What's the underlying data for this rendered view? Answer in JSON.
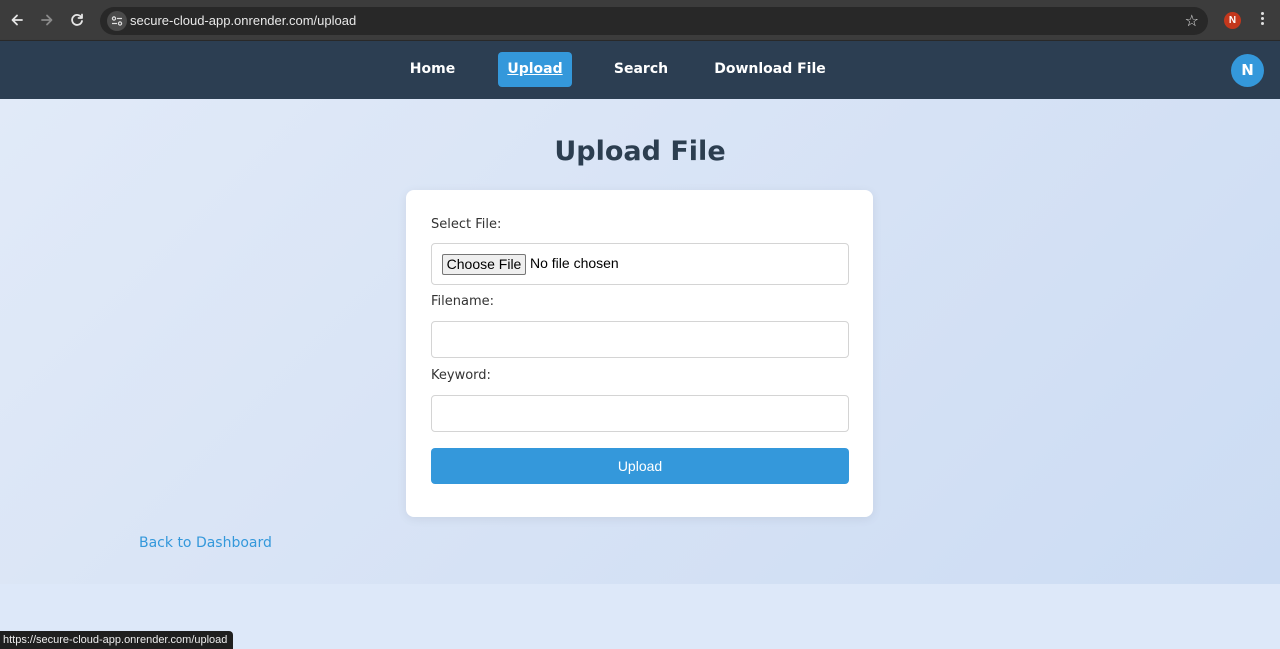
{
  "browser": {
    "url": "secure-cloud-app.onrender.com/upload",
    "profile_initial": "N",
    "status_url": "https://secure-cloud-app.onrender.com/upload",
    "icons": {
      "back": "arrow-left-icon",
      "forward": "arrow-right-icon",
      "reload": "reload-icon",
      "site_info": "tune-icon",
      "bookmark": "star-icon",
      "menu": "kebab-menu-icon"
    }
  },
  "nav": {
    "items": [
      {
        "label": "Home",
        "active": false
      },
      {
        "label": "Upload",
        "active": true
      },
      {
        "label": "Search",
        "active": false
      },
      {
        "label": "Download File",
        "active": false
      }
    ],
    "avatar_initial": "N"
  },
  "page": {
    "title": "Upload File",
    "form": {
      "select_file_label": "Select File:",
      "choose_file_button": "Choose File",
      "file_status": "No file chosen",
      "filename_label": "Filename:",
      "filename_value": "",
      "keyword_label": "Keyword:",
      "keyword_value": "",
      "submit_label": "Upload"
    },
    "back_link": "Back to Dashboard"
  },
  "colors": {
    "nav_bg": "#2c3e52",
    "accent": "#3498db",
    "title": "#2c3e50",
    "page_bg": "#dde7f6",
    "card_bg": "#ffffff"
  }
}
